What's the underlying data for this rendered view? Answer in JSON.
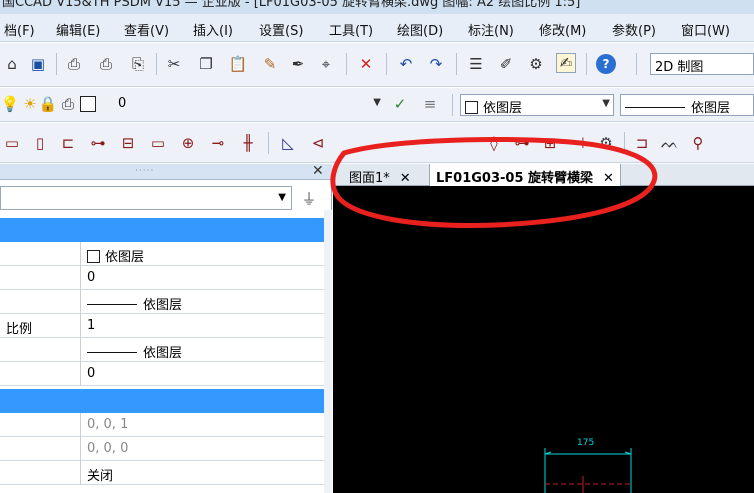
{
  "title": {
    "text": "国CCAD V15&TH PSDM V15 — 企业版 - [LF01G03-05 旋转臂横梁.dwg 图幅: A2 绘图比例 1:5]"
  },
  "menu": [
    "档(F)",
    "编辑(E)",
    "查看(V)",
    "插入(I)",
    "设置(S)",
    "工具(T)",
    "绘图(D)",
    "标注(N)",
    "修改(M)",
    "参数(P)",
    "窗口(W)"
  ],
  "toolbar1": {
    "icons": [
      "open-icon",
      "save-icon",
      "print-preview-icon",
      "print-icon",
      "publish-icon",
      "cut-icon",
      "copy-icon",
      "paste-icon",
      "match-properties-icon",
      "pick-point-icon",
      "select-icon",
      "delete-icon",
      "undo-icon",
      "redo-icon",
      "properties-icon",
      "eraser-icon",
      "tools-icon",
      "edit-note-icon",
      "help-icon"
    ],
    "workspace": "2D 制图"
  },
  "toolbar2": {
    "layer_value": "0",
    "color_value": "依图层",
    "linetype_value": "依图层"
  },
  "panel": {
    "header_color": "#3399ff",
    "rows": [
      {
        "label": "",
        "value": "依图层",
        "kind": "color"
      },
      {
        "label": "",
        "value": "0"
      },
      {
        "label": "",
        "value": "依图层",
        "kind": "line"
      },
      {
        "label": "比例",
        "value": "1"
      },
      {
        "label": "",
        "value": "依图层",
        "kind": "line"
      },
      {
        "label": "",
        "value": "0"
      }
    ],
    "rows2": [
      {
        "label": "",
        "value": "0, 0, 1"
      },
      {
        "label": "",
        "value": "0, 0, 0"
      },
      {
        "label": "",
        "value": "关闭"
      }
    ]
  },
  "tabs": [
    {
      "label": "图面1*",
      "active": false
    },
    {
      "label": "LF01G03-05 旋转臂横梁",
      "active": true
    }
  ],
  "drawing": {
    "dimension": "175"
  },
  "annotation": {
    "color": "#e8201e"
  }
}
